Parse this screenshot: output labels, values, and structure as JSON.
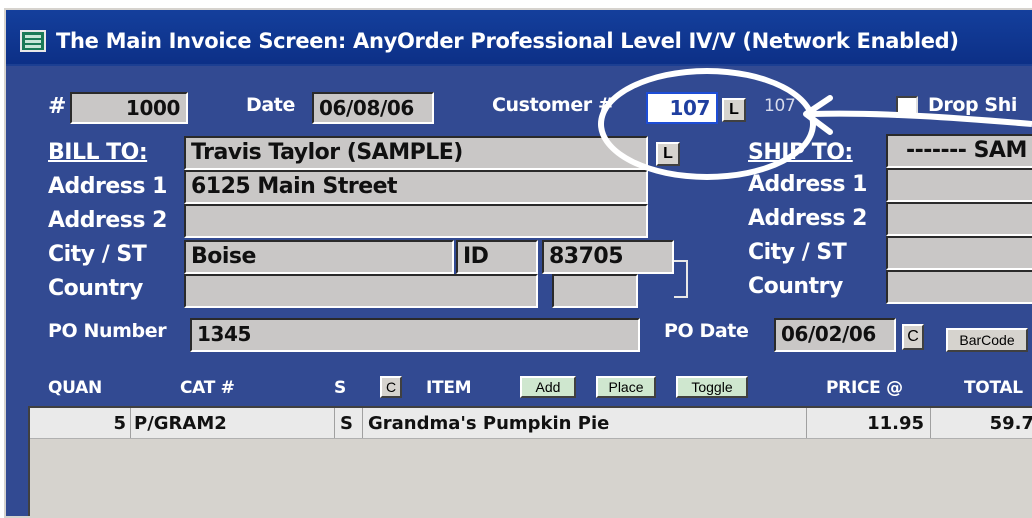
{
  "window": {
    "title": "The Main Invoice Screen:  AnyOrder Professional Level IV/V (Network Enabled)"
  },
  "header": {
    "number_label": "#",
    "number_value": "1000",
    "date_label": "Date",
    "date_value": "06/08/06",
    "customer_label": "Customer #",
    "customer_value": "107",
    "customer_lookup_label": "L",
    "customer_echo": "107",
    "drop_ship_label": "Drop Shi"
  },
  "bill_to": {
    "label": "BILL TO:",
    "lookup_label": "L",
    "name": "Travis Taylor (SAMPLE)",
    "address1_label": "Address 1",
    "address1": "6125 Main Street",
    "address2_label": "Address 2",
    "address2": "",
    "city_label": "City / ST",
    "city": "Boise",
    "state": "ID",
    "zip": "83705",
    "country_label": "Country",
    "country": "",
    "country_extra": ""
  },
  "ship_to": {
    "label": "SHIP TO:",
    "name": "------- SAM",
    "address1_label": "Address 1",
    "address2_label": "Address 2",
    "city_label": "City / ST",
    "country_label": "Country"
  },
  "po": {
    "number_label": "PO Number",
    "number_value": "1345",
    "date_label": "PO Date",
    "date_value": "06/02/06",
    "date_button": "C",
    "barcode_button": "BarCode"
  },
  "grid": {
    "headers": {
      "quan": "QUAN",
      "cat": "CAT #",
      "s": "S",
      "c_button": "C",
      "item": "ITEM",
      "add_button": "Add",
      "place_button": "Place",
      "toggle_button": "Toggle",
      "price": "PRICE @",
      "total": "TOTAL"
    },
    "rows": [
      {
        "quan": "5",
        "cat": "P/GRAM2",
        "s": "S",
        "item": "Grandma's Pumpkin Pie",
        "price": "11.95",
        "total": "59.7"
      }
    ]
  }
}
